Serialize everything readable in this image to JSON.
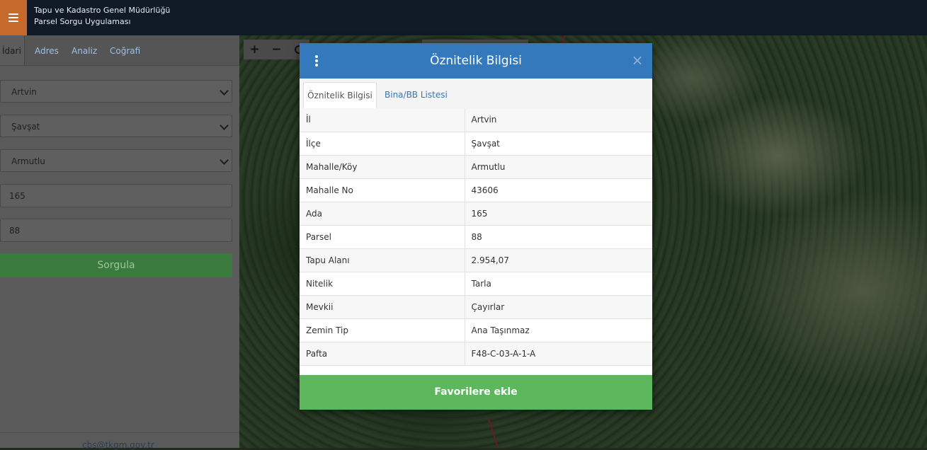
{
  "header": {
    "title_line1": "Tapu ve Kadastro Genel Müdürlüğü",
    "title_line2": "Parsel Sorgu Uygulaması",
    "menu_icon": "hamburger-icon"
  },
  "sidebar": {
    "tabs": [
      {
        "label": "İdari"
      },
      {
        "label": "Adres"
      },
      {
        "label": "Analiz"
      },
      {
        "label": "Coğrafi"
      }
    ],
    "il": "Artvin",
    "ilce": "Şavşat",
    "mahalle": "Armutlu",
    "ada": "165",
    "parsel": "88",
    "query_label": "Sorgula",
    "footer_email": "cbs@tkgm.gov.tr"
  },
  "map_tools": {
    "zoom_in": "+",
    "zoom_out": "−",
    "refresh_icon": "refresh-icon"
  },
  "modal": {
    "title": "Öznitelik Bilgisi",
    "tabs": [
      {
        "label": "Öznitelik Bilgisi"
      },
      {
        "label": "Bina/BB Listesi"
      }
    ],
    "rows": [
      {
        "key": "İl",
        "value": "Artvin"
      },
      {
        "key": "İlçe",
        "value": "Şavşat"
      },
      {
        "key": "Mahalle/Köy",
        "value": "Armutlu"
      },
      {
        "key": "Mahalle No",
        "value": "43606"
      },
      {
        "key": "Ada",
        "value": "165"
      },
      {
        "key": "Parsel",
        "value": "88"
      },
      {
        "key": "Tapu Alanı",
        "value": "2.954,07"
      },
      {
        "key": "Nitelik",
        "value": "Tarla"
      },
      {
        "key": "Mevkii",
        "value": "Çayırlar"
      },
      {
        "key": "Zemin Tip",
        "value": "Ana Taşınmaz"
      },
      {
        "key": "Pafta",
        "value": "F48-C-03-A-1-A"
      }
    ],
    "favorite_label": "Favorilere ekle",
    "close_glyph": "×"
  },
  "colors": {
    "topbar": "#0f1a26",
    "menu_accent": "#c56a2a",
    "modal_header": "#3579bd",
    "favorite_button": "#5cb75d",
    "query_button": "#3b7a3d"
  }
}
